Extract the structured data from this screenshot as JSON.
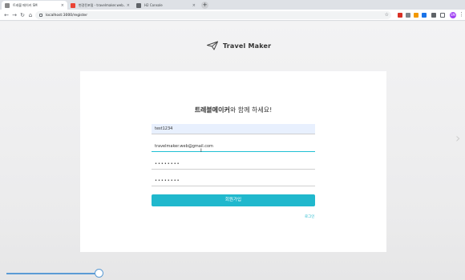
{
  "browser": {
    "tabs": [
      {
        "title": "트레블 메이커 SM",
        "favicon_color": "#888888"
      },
      {
        "title": "변경된포털 - travelmaker.web...",
        "favicon_color": "#ea4335"
      },
      {
        "title": "H2 Console",
        "favicon_color": "#5f6368"
      }
    ],
    "url": "localhost:3000/register",
    "profile_initials": "SM",
    "new_tab_symbol": "+"
  },
  "brand": {
    "name": "Travel Maker",
    "icon": "paper-plane-icon"
  },
  "form": {
    "title_bold": "트레블메이커",
    "title_rest": "와 함께 하세요!",
    "username": "test1234",
    "email": "travelmaker.web@gmail.com",
    "password": "••••••••",
    "password_confirm": "••••••••",
    "submit_label": "회원가입",
    "login_link": "로그인"
  },
  "colors": {
    "accent": "#20b8cd",
    "autofill": "#e8f0fe"
  },
  "video_progress": 0.21
}
